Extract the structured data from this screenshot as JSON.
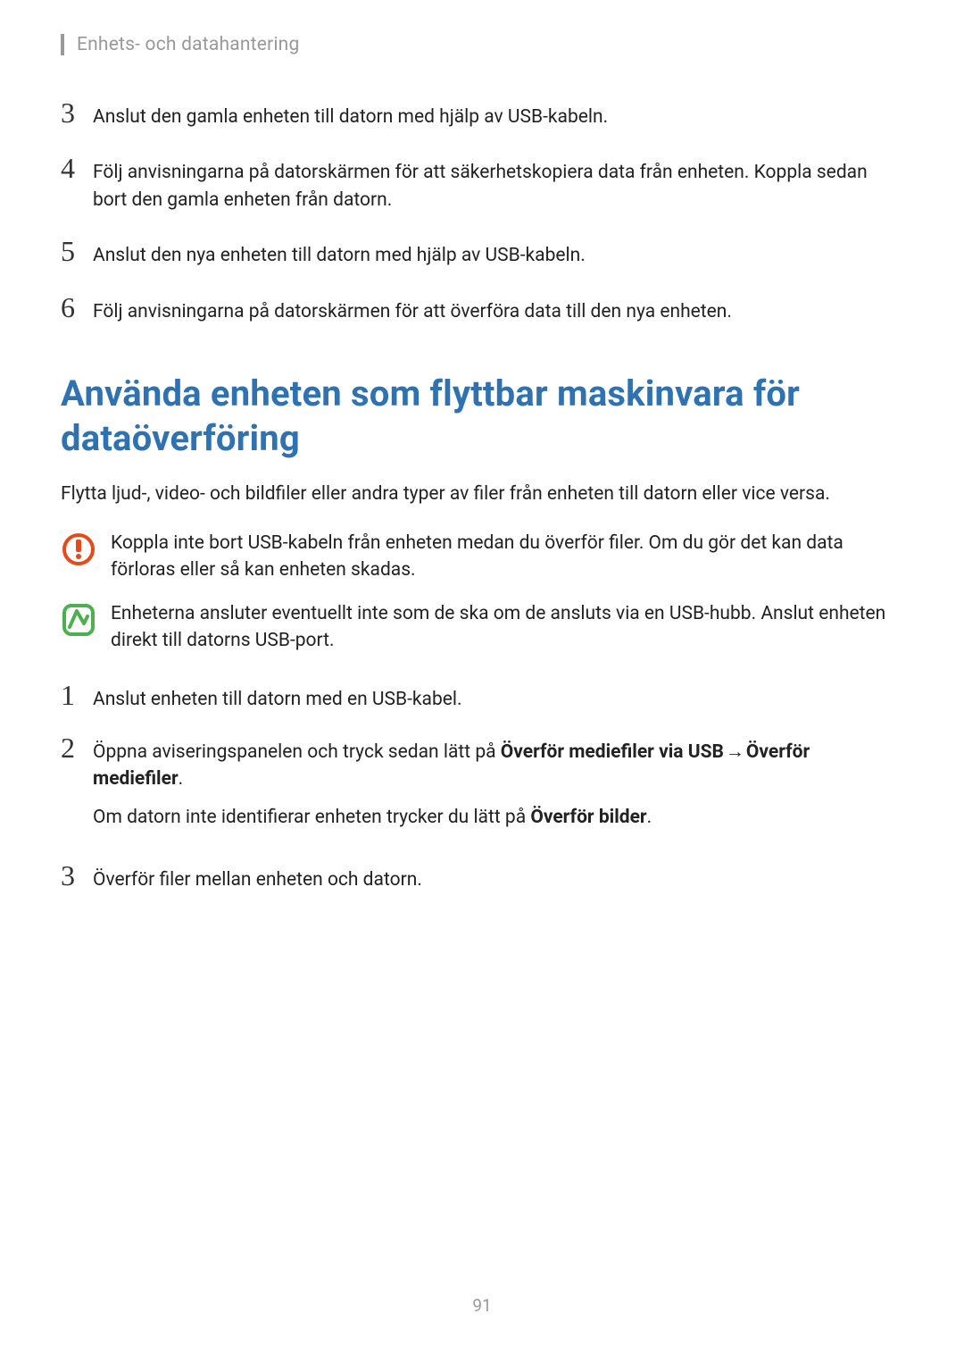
{
  "header": "Enhets- och datahantering",
  "steps_top": [
    {
      "n": "3",
      "text": "Anslut den gamla enheten till datorn med hjälp av USB-kabeln."
    },
    {
      "n": "4",
      "text": "Följ anvisningarna på datorskärmen för att säkerhetskopiera data från enheten. Koppla sedan bort den gamla enheten från datorn."
    },
    {
      "n": "5",
      "text": "Anslut den nya enheten till datorn med hjälp av USB-kabeln."
    },
    {
      "n": "6",
      "text": "Följ anvisningarna på datorskärmen för att överföra data till den nya enheten."
    }
  ],
  "section_title": "Använda enheten som flyttbar maskinvara för dataöverföring",
  "lead": "Flytta ljud-, video- och bildfiler eller andra typer av filer från enheten till datorn eller vice versa.",
  "note_warning": "Koppla inte bort USB-kabeln från enheten medan du överför filer. Om du gör det kan data förloras eller så kan enheten skadas.",
  "note_info": "Enheterna ansluter eventuellt inte som de ska om de ansluts via en USB-hubb. Anslut enheten direkt till datorns USB-port.",
  "steps_bottom": {
    "s1": {
      "n": "1",
      "text": "Anslut enheten till datorn med en USB-kabel."
    },
    "s2": {
      "n": "2",
      "pre": "Öppna aviseringspanelen och tryck sedan lätt på ",
      "bold1": "Överför mediefiler via USB",
      "arrow": " → ",
      "bold2": "Överför mediefiler",
      "period": ".",
      "line2_pre": "Om datorn inte identifierar enheten trycker du lätt på ",
      "line2_bold": "Överför bilder",
      "line2_period": "."
    },
    "s3": {
      "n": "3",
      "text": "Överför filer mellan enheten och datorn."
    }
  },
  "page_number": "91"
}
